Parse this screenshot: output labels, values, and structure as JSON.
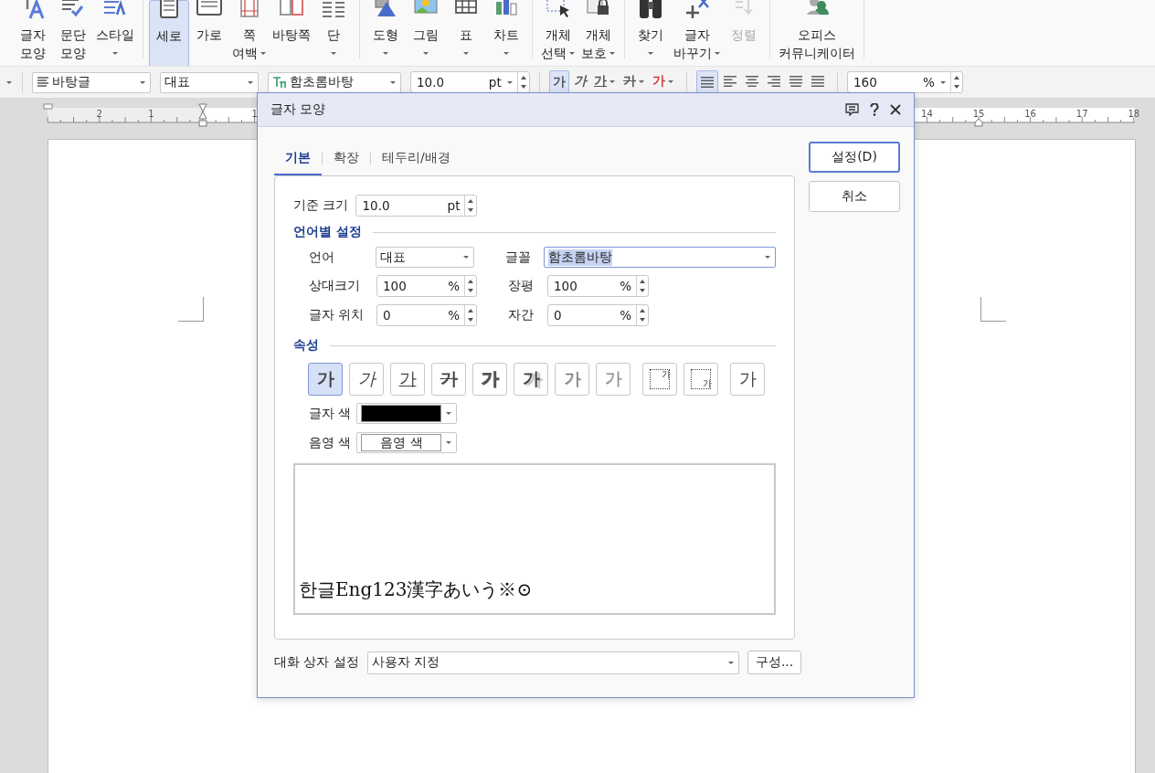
{
  "ribbon": {
    "groups": [
      {
        "items": [
          {
            "lines": [
              "글자",
              "모양"
            ],
            "dropdown": false,
            "selected": false,
            "disabled": false
          },
          {
            "lines": [
              "문단",
              "모양"
            ],
            "dropdown": false,
            "selected": false,
            "disabled": false
          },
          {
            "lines": [
              "스타일"
            ],
            "dropdown": true,
            "selected": false,
            "disabled": false
          }
        ]
      },
      {
        "items": [
          {
            "lines": [
              "세로"
            ],
            "dropdown": false,
            "selected": true,
            "disabled": false
          },
          {
            "lines": [
              "가로"
            ],
            "dropdown": false,
            "selected": false,
            "disabled": false
          },
          {
            "lines": [
              "쪽",
              "여백"
            ],
            "dropdown": true,
            "selected": false,
            "disabled": false
          },
          {
            "lines": [
              "바탕쪽"
            ],
            "dropdown": false,
            "selected": false,
            "disabled": false
          },
          {
            "lines": [
              "단"
            ],
            "dropdown": true,
            "selected": false,
            "disabled": false
          }
        ]
      },
      {
        "items": [
          {
            "lines": [
              "도형"
            ],
            "dropdown": true,
            "selected": false,
            "disabled": false
          },
          {
            "lines": [
              "그림"
            ],
            "dropdown": true,
            "selected": false,
            "disabled": false
          },
          {
            "lines": [
              "표"
            ],
            "dropdown": true,
            "selected": false,
            "disabled": false
          },
          {
            "lines": [
              "차트"
            ],
            "dropdown": true,
            "selected": false,
            "disabled": false
          }
        ]
      },
      {
        "items": [
          {
            "lines": [
              "개체",
              "선택"
            ],
            "dropdown": true,
            "selected": false,
            "disabled": false
          },
          {
            "lines": [
              "개체",
              "보호"
            ],
            "dropdown": true,
            "selected": false,
            "disabled": false
          }
        ]
      },
      {
        "items": [
          {
            "lines": [
              "찾기"
            ],
            "dropdown": true,
            "selected": false,
            "disabled": false
          },
          {
            "lines": [
              "글자",
              "바꾸기"
            ],
            "dropdown": true,
            "selected": false,
            "disabled": false
          },
          {
            "lines": [
              "정렬"
            ],
            "dropdown": false,
            "selected": false,
            "disabled": true
          }
        ]
      },
      {
        "items": [
          {
            "lines": [
              "오피스",
              "커뮤니케이터"
            ],
            "dropdown": false,
            "selected": false,
            "disabled": false
          }
        ]
      }
    ]
  },
  "format_toolbar": {
    "style": "바탕글",
    "language": "대표",
    "font": "함초롬바탕",
    "size": "10.0",
    "size_unit": "pt",
    "char_buttons": [
      {
        "kind": "bold",
        "glyph": "가",
        "selected": true,
        "dropdown": false
      },
      {
        "kind": "italic",
        "glyph": "가",
        "selected": false,
        "dropdown": false
      },
      {
        "kind": "underline",
        "glyph": "가",
        "selected": false,
        "dropdown": true
      },
      {
        "kind": "strike",
        "glyph": "가",
        "selected": false,
        "dropdown": true
      },
      {
        "kind": "font-color",
        "glyph": "가",
        "selected": false,
        "dropdown": true
      }
    ],
    "align_buttons": [
      {
        "kind": "justify",
        "selected": true
      },
      {
        "kind": "left",
        "selected": false
      },
      {
        "kind": "center",
        "selected": false
      },
      {
        "kind": "right",
        "selected": false
      },
      {
        "kind": "distribute",
        "selected": false
      },
      {
        "kind": "divide",
        "selected": false
      }
    ],
    "zoom": "160",
    "zoom_unit": "%"
  },
  "ruler": {
    "left_labels": [
      "2",
      "1"
    ],
    "right_labels": [
      "1",
      "14",
      "15",
      "16",
      "17",
      "18"
    ]
  },
  "dialog": {
    "title": "글자 모양",
    "tabs": [
      {
        "label": "기본",
        "selected": true
      },
      {
        "label": "확장",
        "selected": false
      },
      {
        "label": "테두리/배경",
        "selected": false
      }
    ],
    "base_size": {
      "label": "기준 크기",
      "value": "10.0",
      "unit": "pt"
    },
    "language_section": {
      "title": "언어별 설정",
      "language": {
        "label": "언어",
        "value": "대표"
      },
      "font": {
        "label": "글꼴",
        "value": "함초롬바탕",
        "highlighted": true
      },
      "fields": [
        {
          "label": "상대크기",
          "value": "100",
          "unit": "%"
        },
        {
          "label": "장평",
          "value": "100",
          "unit": "%"
        },
        {
          "label": "글자 위치",
          "value": "0",
          "unit": "%"
        },
        {
          "label": "자간",
          "value": "0",
          "unit": "%"
        }
      ]
    },
    "attributes_section": {
      "title": "속성",
      "buttons": [
        {
          "kind": "bold",
          "glyph": "가",
          "selected": true
        },
        {
          "kind": "italic",
          "glyph": "가",
          "selected": false
        },
        {
          "kind": "underline",
          "glyph": "가",
          "selected": false
        },
        {
          "kind": "strike",
          "glyph": "가",
          "selected": false
        },
        {
          "kind": "outline",
          "glyph": "가",
          "selected": false
        },
        {
          "kind": "shadow",
          "glyph": "가",
          "selected": false
        },
        {
          "kind": "emboss",
          "glyph": "가",
          "selected": false
        },
        {
          "kind": "engrave",
          "glyph": "가",
          "selected": false
        },
        {
          "kind": "superscript",
          "glyph": "가",
          "selected": false
        },
        {
          "kind": "subscript",
          "glyph": "가",
          "selected": false
        },
        {
          "kind": "normal",
          "glyph": "가",
          "selected": false
        }
      ],
      "text_color": {
        "label": "글자 색",
        "color": "#000000"
      },
      "shade_color": {
        "label": "음영 색",
        "value": "음영 색"
      }
    },
    "preview": "한글Eng123漢字あいう※⊙",
    "dialog_setting": {
      "label": "대화 상자 설정",
      "value": "사용자 지정"
    },
    "configure_button": "구성...",
    "buttons": [
      {
        "label": "설정(D)",
        "default": true
      },
      {
        "label": "취소",
        "default": false
      }
    ]
  }
}
